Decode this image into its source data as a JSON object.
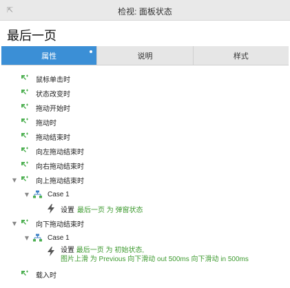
{
  "window": {
    "title": "检视: 面板状态",
    "collapse_glyph": "⇱"
  },
  "page_name": "最后一页",
  "tabs": [
    {
      "label": "属性",
      "active": true,
      "has_dot": true
    },
    {
      "label": "说明",
      "active": false
    },
    {
      "label": "样式",
      "active": false
    }
  ],
  "events": {
    "on_click": "鼠标单击时",
    "on_state_change": "状态改变时",
    "on_drag_start": "拖动开始时",
    "on_drag": "拖动时",
    "on_drag_end": "拖动结束时",
    "on_swipe_left": "向左拖动结束时",
    "on_swipe_right": "向右拖动结束时",
    "on_swipe_up": "向上拖动结束时",
    "on_swipe_down": "向下拖动结束时",
    "on_load": "载入时"
  },
  "cases": {
    "up_case": "Case 1",
    "down_case": "Case 1"
  },
  "actions": {
    "up_action_prefix": "设置",
    "up_action_detail": "最后一页 为 弹窗状态",
    "down_action_prefix": "设置",
    "down_action_detail_line1": "最后一页 为 初始状态,",
    "down_action_detail_line2": "图片上滑 为 Previous 向下滑动 out 500ms 向下滑动 in 500ms"
  },
  "colors": {
    "accent_tab": "#3b8fd6",
    "action_green": "#3d9a2f",
    "event_icon_green": "#4caf50",
    "case_icon_blue": "#3b7fc4",
    "bolt_gray": "#555555"
  },
  "icons": {
    "event": "cursor-event-icon",
    "case": "case-flow-icon",
    "action": "lightning-bolt-icon",
    "expand": "triangle-down-icon"
  }
}
